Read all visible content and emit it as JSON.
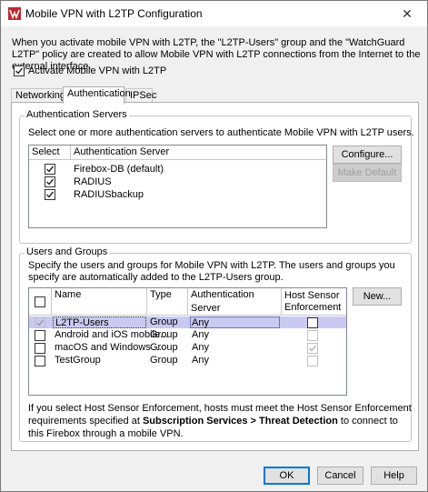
{
  "window": {
    "title": "Mobile VPN with L2TP Configuration",
    "close_glyph": "✕"
  },
  "intro_text": "When you activate mobile VPN with L2TP, the \"L2TP-Users\" group and the \"WatchGuard L2TP\" policy are created to allow Mobile VPN with L2TP connections from the Internet to the external interface.",
  "activate": {
    "label": "Activate Mobile VPN with L2TP",
    "checked": true
  },
  "tabs": [
    {
      "label": "Networking",
      "active": false
    },
    {
      "label": "Authentication",
      "active": true
    },
    {
      "label": "IPSec",
      "active": false
    }
  ],
  "auth_servers": {
    "legend": "Authentication Servers",
    "description": "Select one or more authentication servers to authenticate Mobile VPN with L2TP users.",
    "columns": [
      "Select",
      "Authentication Server"
    ],
    "rows": [
      {
        "selected": true,
        "name": "Firebox-DB  (default)"
      },
      {
        "selected": true,
        "name": "RADIUS"
      },
      {
        "selected": true,
        "name": "RADIUSbackup"
      }
    ],
    "configure_label": "Configure...",
    "make_default_label": "Make Default"
  },
  "users_groups": {
    "legend": "Users and Groups",
    "description": "Specify the users and groups for Mobile VPN with L2TP. The users and groups you specify are automatically added to the L2TP-Users group.",
    "columns": [
      "Name",
      "Type",
      "Authentication Server",
      "Host Sensor Enforcement"
    ],
    "host_sensor_col_line1": "Host Sensor",
    "host_sensor_col_line2": "Enforcement",
    "rows": [
      {
        "checked": true,
        "disabled": true,
        "name": "L2TP-Users",
        "type": "Group",
        "server": "Any",
        "hse": false,
        "hse_disabled": false
      },
      {
        "checked": false,
        "disabled": false,
        "name": "Android and iOS mobile...",
        "type": "Group",
        "server": "Any",
        "hse": false,
        "hse_disabled": true
      },
      {
        "checked": false,
        "disabled": false,
        "name": "macOS and Windows ...",
        "type": "Group",
        "server": "Any",
        "hse": true,
        "hse_disabled": true
      },
      {
        "checked": false,
        "disabled": false,
        "name": "TestGroup",
        "type": "Group",
        "server": "Any",
        "hse": false,
        "hse_disabled": true
      }
    ],
    "new_label": "New..."
  },
  "footer_note": {
    "part1": "If you select Host Sensor Enforcement, hosts must meet the Host Sensor Enforcement requirements specified at ",
    "bold": "Subscription Services > Threat Detection",
    "part2": " to connect to this Firebox through a mobile VPN."
  },
  "buttons": {
    "ok": "OK",
    "cancel": "Cancel",
    "help": "Help"
  },
  "colors": {
    "accent": "#0078d7",
    "selection": "#c9c9f2",
    "app_icon": "#c1272d"
  }
}
